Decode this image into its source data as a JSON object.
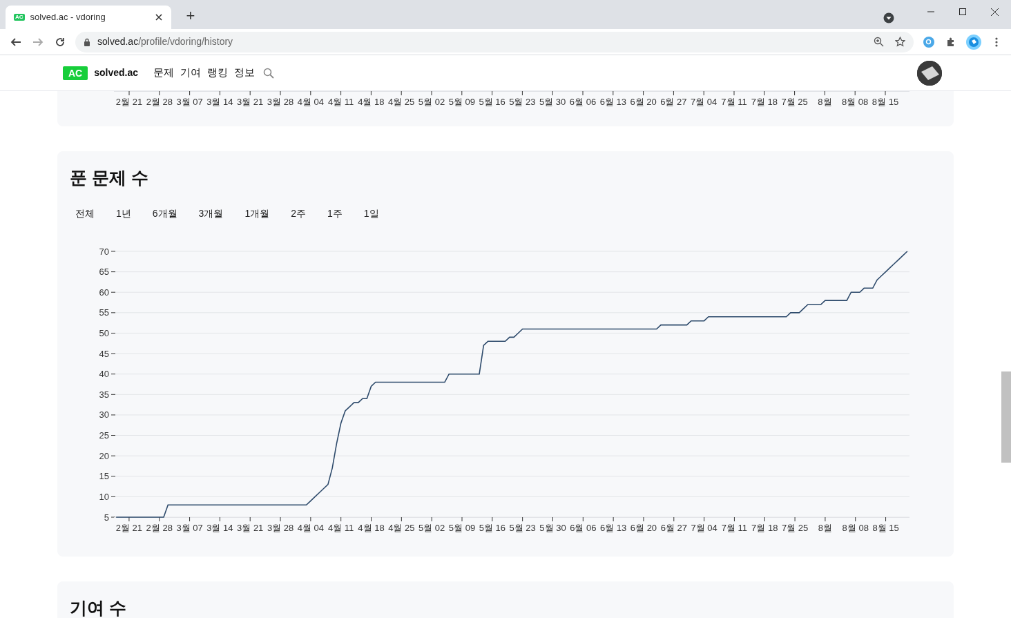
{
  "browser": {
    "tab_title": "solved.ac - vdoring",
    "favicon_text": "AC",
    "new_tab": "+",
    "url_host": "solved.ac",
    "url_path": "/profile/vdoring/history"
  },
  "site_header": {
    "logo_badge": "AC",
    "logo_text": "solved.ac",
    "nav": [
      "문제",
      "기여",
      "랭킹",
      "정보"
    ]
  },
  "previous_chart": {
    "x_labels": [
      "2월 21",
      "2월 28",
      "3월 07",
      "3월 14",
      "3월 21",
      "3월 28",
      "4월 04",
      "4월 11",
      "4월 18",
      "4월 25",
      "5월 02",
      "5월 09",
      "5월 16",
      "5월 23",
      "5월 30",
      "6월 06",
      "6월 13",
      "6월 20",
      "6월 27",
      "7월 04",
      "7월 11",
      "7월 18",
      "7월 25",
      "8월",
      "8월 08",
      "8월 15"
    ]
  },
  "solved_section": {
    "title": "푼 문제 수",
    "ranges": [
      "전체",
      "1년",
      "6개월",
      "3개월",
      "1개월",
      "2주",
      "1주",
      "1일"
    ],
    "chart_data": {
      "type": "line",
      "categories": [
        null,
        null,
        null,
        "2월 21",
        null,
        null,
        null,
        null,
        null,
        null,
        "2월 28",
        null,
        null,
        null,
        null,
        null,
        null,
        "3월 07",
        null,
        null,
        null,
        null,
        null,
        null,
        "3월 14",
        null,
        null,
        null,
        null,
        null,
        null,
        "3월 21",
        null,
        null,
        null,
        null,
        null,
        null,
        "3월 28",
        null,
        null,
        null,
        null,
        null,
        null,
        "4월 04",
        null,
        null,
        null,
        null,
        null,
        null,
        "4월 11",
        null,
        null,
        null,
        null,
        null,
        null,
        "4월 18",
        null,
        null,
        null,
        null,
        null,
        null,
        "4월 25",
        null,
        null,
        null,
        null,
        null,
        null,
        "5월 02",
        null,
        null,
        null,
        null,
        null,
        null,
        "5월 09",
        null,
        null,
        null,
        null,
        null,
        null,
        "5월 16",
        null,
        null,
        null,
        null,
        null,
        null,
        "5월 23",
        null,
        null,
        null,
        null,
        null,
        null,
        "5월 30",
        null,
        null,
        null,
        null,
        null,
        null,
        "6월 06",
        null,
        null,
        null,
        null,
        null,
        null,
        "6월 13",
        null,
        null,
        null,
        null,
        null,
        null,
        "6월 20",
        null,
        null,
        null,
        null,
        null,
        null,
        "6월 27",
        null,
        null,
        null,
        null,
        null,
        null,
        "7월 04",
        null,
        null,
        null,
        null,
        null,
        null,
        "7월 11",
        null,
        null,
        null,
        null,
        null,
        null,
        "7월 18",
        null,
        null,
        null,
        null,
        null,
        null,
        "7월 25",
        null,
        null,
        null,
        null,
        null,
        null,
        "8월",
        null,
        null,
        null,
        null,
        null,
        null,
        "8월 08",
        null,
        null,
        null,
        null,
        null,
        null,
        "8월 15",
        null,
        null,
        null,
        null,
        null
      ],
      "series": [
        {
          "color": "#2d4a6b",
          "values": [
            5,
            5,
            5,
            5,
            5,
            5,
            5,
            5,
            5,
            5,
            5,
            5,
            8,
            8,
            8,
            8,
            8,
            8,
            8,
            8,
            8,
            8,
            8,
            8,
            8,
            8,
            8,
            8,
            8,
            8,
            8,
            8,
            8,
            8,
            8,
            8,
            8,
            8,
            8,
            8,
            8,
            8,
            8,
            8,
            8,
            9,
            10,
            11,
            12,
            13,
            17,
            23,
            28,
            31,
            32,
            33,
            33,
            34,
            34,
            37,
            38,
            38,
            38,
            38,
            38,
            38,
            38,
            38,
            38,
            38,
            38,
            38,
            38,
            38,
            38,
            38,
            38,
            40,
            40,
            40,
            40,
            40,
            40,
            40,
            40,
            47,
            48,
            48,
            48,
            48,
            48,
            49,
            49,
            50,
            51,
            51,
            51,
            51,
            51,
            51,
            51,
            51,
            51,
            51,
            51,
            51,
            51,
            51,
            51,
            51,
            51,
            51,
            51,
            51,
            51,
            51,
            51,
            51,
            51,
            51,
            51,
            51,
            51,
            51,
            51,
            51,
            52,
            52,
            52,
            52,
            52,
            52,
            52,
            53,
            53,
            53,
            53,
            54,
            54,
            54,
            54,
            54,
            54,
            54,
            54,
            54,
            54,
            54,
            54,
            54,
            54,
            54,
            54,
            54,
            54,
            54,
            55,
            55,
            55,
            56,
            57,
            57,
            57,
            57,
            58,
            58,
            58,
            58,
            58,
            58,
            60,
            60,
            60,
            61,
            61,
            61,
            63,
            64,
            65,
            66,
            67,
            68,
            69,
            70
          ]
        }
      ],
      "grid": true,
      "ylim": [
        5,
        70
      ],
      "yticks": [
        5,
        10,
        15,
        20,
        25,
        30,
        35,
        40,
        45,
        50,
        55,
        60,
        65,
        70
      ]
    }
  },
  "next_section": {
    "title": "기여 수"
  }
}
